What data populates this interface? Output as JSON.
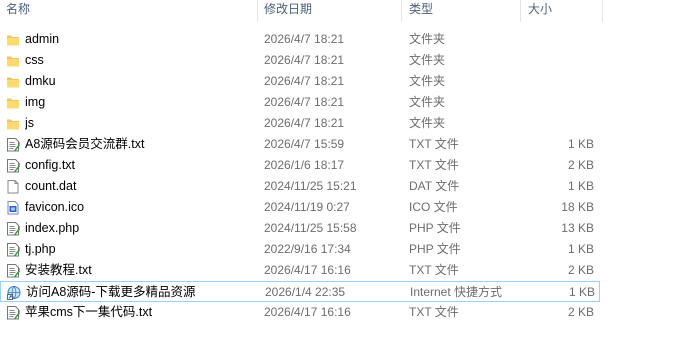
{
  "columns": {
    "name": "名称",
    "modified": "修改日期",
    "type": "类型",
    "size": "大小"
  },
  "files": [
    {
      "name": "admin",
      "modified": "2026/4/7 18:21",
      "type": "文件夹",
      "size": "",
      "icon": "folder-icon"
    },
    {
      "name": "css",
      "modified": "2026/4/7 18:21",
      "type": "文件夹",
      "size": "",
      "icon": "folder-icon"
    },
    {
      "name": "dmku",
      "modified": "2026/4/7 18:21",
      "type": "文件夹",
      "size": "",
      "icon": "folder-icon"
    },
    {
      "name": "img",
      "modified": "2026/4/7 18:21",
      "type": "文件夹",
      "size": "",
      "icon": "folder-icon"
    },
    {
      "name": "js",
      "modified": "2026/4/7 18:21",
      "type": "文件夹",
      "size": "",
      "icon": "folder-icon"
    },
    {
      "name": "A8源码会员交流群.txt",
      "modified": "2026/4/7 15:59",
      "type": "TXT 文件",
      "size": "1 KB",
      "icon": "text-file-icon"
    },
    {
      "name": "config.txt",
      "modified": "2026/1/6 18:17",
      "type": "TXT 文件",
      "size": "2 KB",
      "icon": "text-file-icon"
    },
    {
      "name": "count.dat",
      "modified": "2024/11/25 15:21",
      "type": "DAT 文件",
      "size": "1 KB",
      "icon": "blank-file-icon"
    },
    {
      "name": "favicon.ico",
      "modified": "2024/11/19 0:27",
      "type": "ICO 文件",
      "size": "18 KB",
      "icon": "image-file-icon"
    },
    {
      "name": "index.php",
      "modified": "2024/11/25 15:58",
      "type": "PHP 文件",
      "size": "13 KB",
      "icon": "text-file-icon"
    },
    {
      "name": "tj.php",
      "modified": "2022/9/16 17:34",
      "type": "PHP 文件",
      "size": "1 KB",
      "icon": "text-file-icon"
    },
    {
      "name": "安装教程.txt",
      "modified": "2026/4/17 16:16",
      "type": "TXT 文件",
      "size": "2 KB",
      "icon": "text-file-icon"
    },
    {
      "name": "访问A8源码-下载更多精品资源",
      "modified": "2026/1/4 22:35",
      "type": "Internet 快捷方式",
      "size": "1 KB",
      "icon": "internet-shortcut-icon",
      "selected": true
    },
    {
      "name": "苹果cms下一集代码.txt",
      "modified": "2026/4/17 16:16",
      "type": "TXT 文件",
      "size": "2 KB",
      "icon": "text-file-icon"
    }
  ]
}
